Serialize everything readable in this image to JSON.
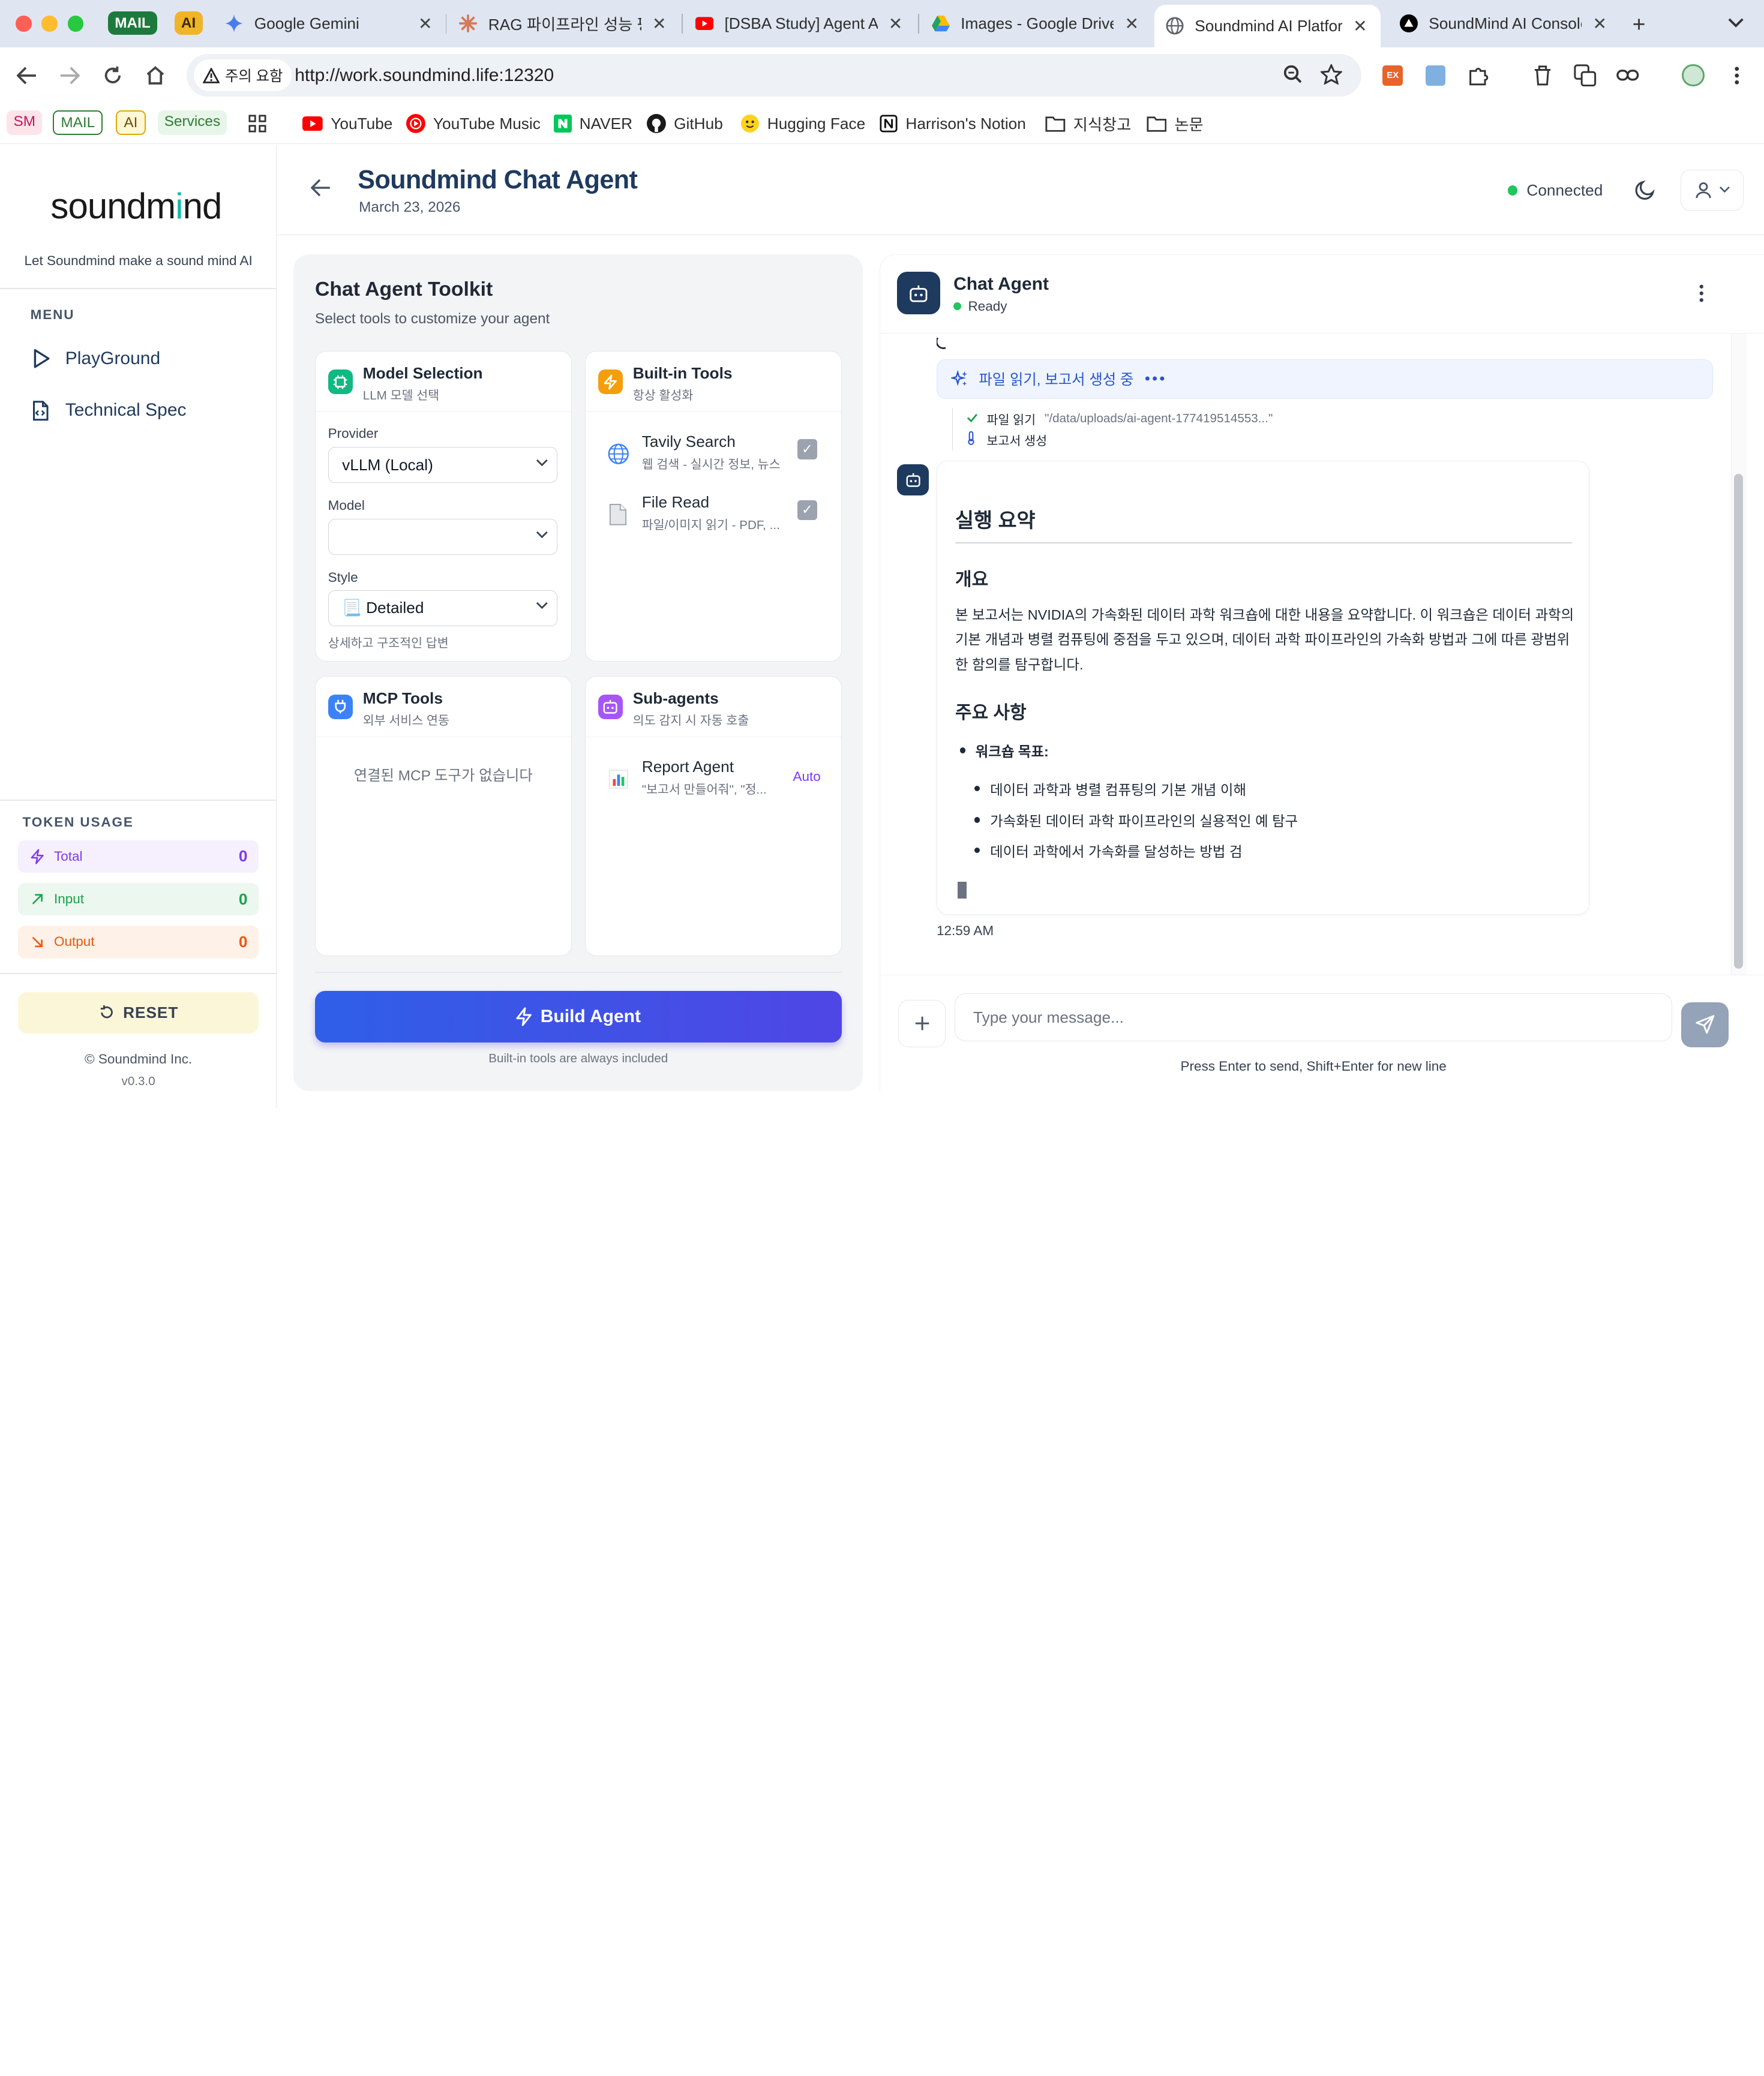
{
  "browser": {
    "groups": [
      {
        "label": "MAIL",
        "color": "#1e7a3c"
      },
      {
        "label": "AI",
        "color": "#f0b428"
      }
    ],
    "tabs": [
      {
        "title": "Google Gemini"
      },
      {
        "title": "RAG 파이프라인 성능 평가"
      },
      {
        "title": "[DSBA Study] Agent A"
      },
      {
        "title": "Images - Google Drive"
      },
      {
        "title": "Soundmind AI Platform"
      },
      {
        "title": "SoundMind AI Console"
      }
    ],
    "new_tab": "+",
    "security_label": "주의 요함",
    "url": "http://work.soundmind.life:12320",
    "ext_label": "EX"
  },
  "bookmarks": {
    "chips": [
      "SM",
      "MAIL",
      "AI",
      "Services"
    ],
    "items": [
      {
        "label": "YouTube",
        "icon": "youtube-icon"
      },
      {
        "label": "YouTube Music",
        "icon": "youtube-music-icon"
      },
      {
        "label": "NAVER",
        "icon": "naver-icon"
      },
      {
        "label": "GitHub",
        "icon": "github-icon"
      },
      {
        "label": "Hugging Face",
        "icon": "hugging-face-icon"
      },
      {
        "label": "Harrison's Notion",
        "icon": "notion-icon"
      },
      {
        "label": "지식창고",
        "icon": "folder-icon"
      },
      {
        "label": "논문",
        "icon": "folder-icon"
      }
    ]
  },
  "sidebar": {
    "logo_a": "soundm",
    "logo_b": "i",
    "logo_c": "nd",
    "tagline": "Let Soundmind make a sound mind AI",
    "menu_label": "MENU",
    "menu": [
      {
        "label": "PlayGround"
      },
      {
        "label": "Technical Spec"
      }
    ],
    "token_usage_label": "TOKEN USAGE",
    "tokens": [
      {
        "label": "Total",
        "value": "0"
      },
      {
        "label": "Input",
        "value": "0"
      },
      {
        "label": "Output",
        "value": "0"
      }
    ],
    "reset_label": "RESET",
    "copyright": "© Soundmind Inc.",
    "version": "v0.3.0"
  },
  "header": {
    "title": "Soundmind Chat Agent",
    "date": "March 23, 2026",
    "status": "Connected"
  },
  "toolkit": {
    "title": "Chat Agent Toolkit",
    "subtitle": "Select tools to customize your agent",
    "model": {
      "title": "Model Selection",
      "subtitle": "LLM 모델 선택",
      "provider_label": "Provider",
      "provider_value": "vLLM (Local)",
      "model_label": "Model",
      "model_value": "",
      "style_label": "Style",
      "style_value": "📃 Detailed",
      "style_hint": "상세하고 구조적인 답변"
    },
    "builtin": {
      "title": "Built-in Tools",
      "subtitle": "항상 활성화",
      "tools": [
        {
          "name": "Tavily Search",
          "desc": "웹 검색 - 실시간 정보, 뉴스",
          "checked": true
        },
        {
          "name": "File Read",
          "desc": "파일/이미지 읽기 - PDF, ...",
          "checked": true
        }
      ]
    },
    "mcp": {
      "title": "MCP Tools",
      "subtitle": "외부 서비스 연동",
      "empty": "연결된 MCP 도구가 없습니다"
    },
    "subagents": {
      "title": "Sub-agents",
      "subtitle": "의도 감지 시 자동 호출",
      "agents": [
        {
          "name": "Report Agent",
          "desc": "\"보고서 만들어줘\", \"정...",
          "badge": "Auto"
        }
      ]
    },
    "build_label": "Build Agent",
    "build_note": "Built-in tools are always included"
  },
  "chat": {
    "agent_name": "Chat Agent",
    "agent_status": "Ready",
    "progress_label": "파일 읽기, 보고서 생성 중",
    "progress_dots": "•••",
    "steps": [
      {
        "label": "파일 읽기",
        "detail": "\"/data/uploads/ai-agent-177419514553...\"",
        "state": "done"
      },
      {
        "label": "보고서 생성",
        "detail": "",
        "state": "running"
      }
    ],
    "message": {
      "h1": "실행 요약",
      "h2_overview": "개요",
      "paragraph": "본 보고서는 NVIDIA의 가속화된 데이터 과학 워크숍에 대한 내용을 요약합니다. 이 워크숍은 데이터 과학의 기본 개념과 병렬 컴퓨팅에 중점을 두고 있으며, 데이터 과학 파이프라인의 가속화 방법과 그에 따른 광범위한 함의를 탐구합니다.",
      "h2_key": "주요 사항",
      "bullet_main": "워크숍 목표:",
      "sub_bullets": [
        "데이터 과학과 병렬 컴퓨팅의 기본 개념 이해",
        "가속화된 데이터 과학 파이프라인의 실용적인 예 탐구",
        "데이터 과학에서 가속화를 달성하는 방법 검"
      ]
    },
    "time": "12:59 AM",
    "input_placeholder": "Type your message...",
    "input_value": "",
    "hint": "Press Enter to send, Shift+Enter for new line"
  },
  "colors": {
    "accent_blue": "#2f5fe8",
    "brand_navy": "#1e3a5f",
    "connected_green": "#22c55e",
    "total_purple": "#7c3aed",
    "input_green": "#16a34a",
    "output_orange": "#ea580c"
  }
}
